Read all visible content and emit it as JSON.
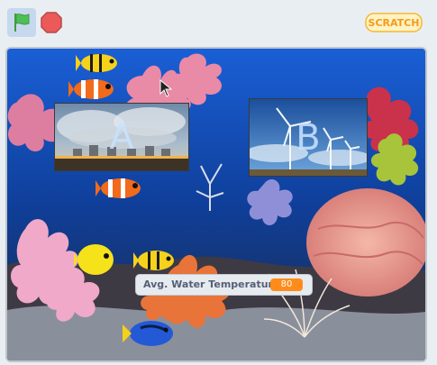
{
  "topbar": {
    "green_flag_icon": "green-flag",
    "stop_icon": "stop-sign",
    "logo_text": "SCRATCH"
  },
  "stage": {
    "card_a_letter": "A",
    "card_b_letter": "B",
    "monitor": {
      "label": "Avg. Water Temperature",
      "value": "80"
    }
  },
  "colors": {
    "monitor_value_bg": "#ff8c1a",
    "flag_green": "#4cbf56",
    "stop_red": "#ec5959"
  }
}
